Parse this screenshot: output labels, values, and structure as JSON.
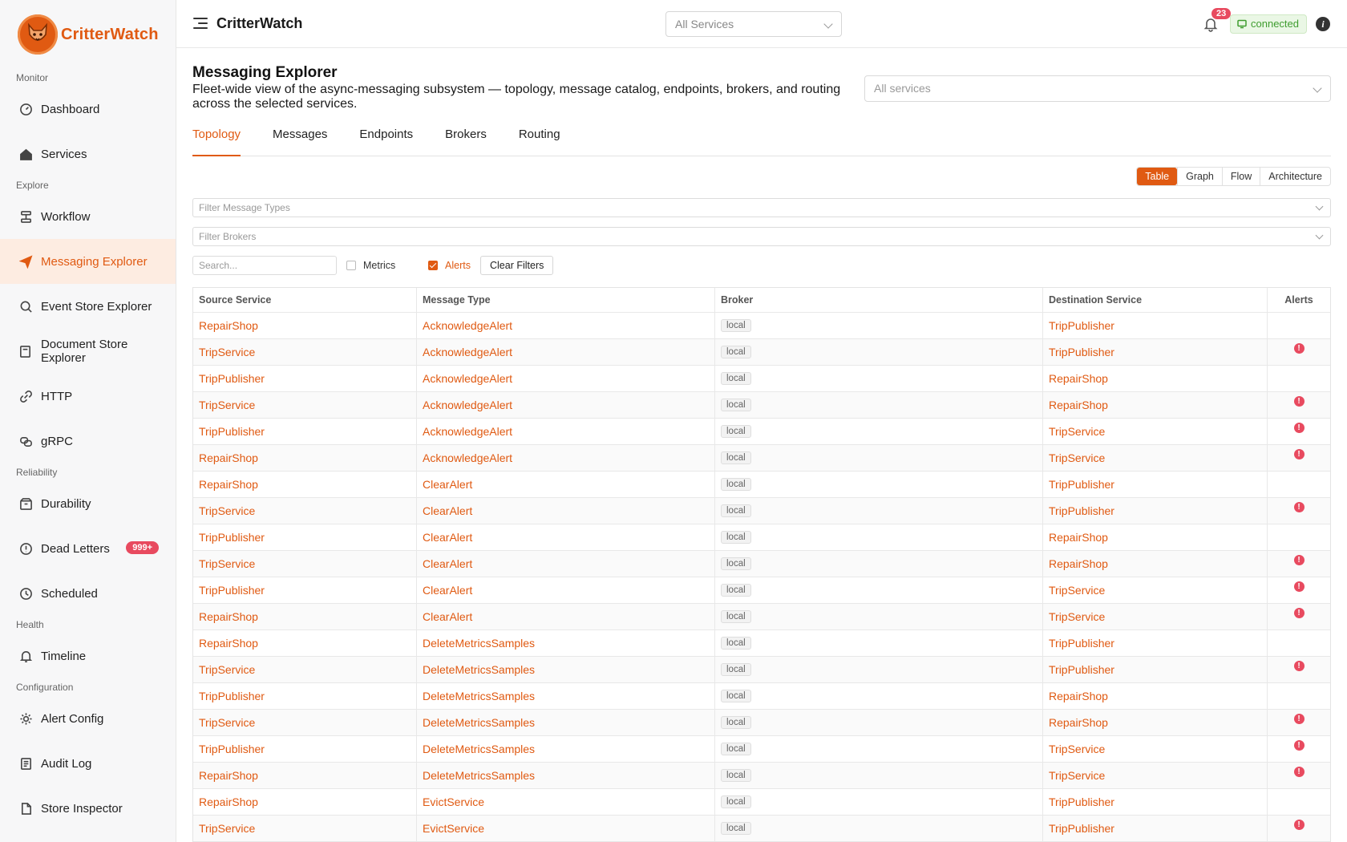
{
  "brand": {
    "name": "CritterWatch"
  },
  "topbar": {
    "title": "CritterWatch",
    "service_select": "All Services",
    "notifications_count": "23",
    "connection_status": "connected"
  },
  "sidebar": {
    "sections": [
      {
        "label": "Monitor",
        "items": [
          {
            "label": "Dashboard",
            "icon": "gauge-icon"
          },
          {
            "label": "Services",
            "icon": "home-icon"
          }
        ]
      },
      {
        "label": "Explore",
        "items": [
          {
            "label": "Workflow",
            "icon": "workflow-icon"
          },
          {
            "label": "Messaging Explorer",
            "icon": "send-icon",
            "active": true
          },
          {
            "label": "Event Store Explorer",
            "icon": "search-icon"
          },
          {
            "label": "Document Store Explorer",
            "icon": "book-icon"
          },
          {
            "label": "HTTP",
            "icon": "link-icon"
          },
          {
            "label": "gRPC",
            "icon": "grpc-icon"
          }
        ]
      },
      {
        "label": "Reliability",
        "items": [
          {
            "label": "Durability",
            "icon": "package-icon"
          },
          {
            "label": "Dead Letters",
            "icon": "alert-circle-icon",
            "badge": "999+"
          },
          {
            "label": "Scheduled",
            "icon": "clock-icon"
          }
        ]
      },
      {
        "label": "Health",
        "items": [
          {
            "label": "Timeline",
            "icon": "bell-icon"
          }
        ]
      },
      {
        "label": "Configuration",
        "items": [
          {
            "label": "Alert Config",
            "icon": "gear-icon"
          },
          {
            "label": "Audit Log",
            "icon": "log-icon"
          },
          {
            "label": "Store Inspector",
            "icon": "file-icon"
          }
        ]
      }
    ]
  },
  "page": {
    "title": "Messaging Explorer",
    "description": "Fleet-wide view of the async-messaging subsystem — topology, message catalog, endpoints, brokers, and routing across the selected services.",
    "services_select": "All services",
    "tabs": [
      "Topology",
      "Messages",
      "Endpoints",
      "Brokers",
      "Routing"
    ],
    "active_tab": "Topology",
    "view_modes": [
      "Table",
      "Graph",
      "Flow",
      "Architecture"
    ],
    "active_view": "Table",
    "filter_message_types_placeholder": "Filter Message Types",
    "filter_brokers_placeholder": "Filter Brokers",
    "search_placeholder": "Search...",
    "metrics_label": "Metrics",
    "metrics_checked": false,
    "alerts_label": "Alerts",
    "alerts_checked": true,
    "clear_filters_label": "Clear Filters"
  },
  "table": {
    "columns": [
      "Source Service",
      "Message Type",
      "Broker",
      "Destination Service",
      "Alerts"
    ],
    "rows": [
      {
        "source": "RepairShop",
        "message": "AcknowledgeAlert",
        "broker": "local",
        "destination": "TripPublisher",
        "alert": false
      },
      {
        "source": "TripService",
        "message": "AcknowledgeAlert",
        "broker": "local",
        "destination": "TripPublisher",
        "alert": true
      },
      {
        "source": "TripPublisher",
        "message": "AcknowledgeAlert",
        "broker": "local",
        "destination": "RepairShop",
        "alert": false
      },
      {
        "source": "TripService",
        "message": "AcknowledgeAlert",
        "broker": "local",
        "destination": "RepairShop",
        "alert": true
      },
      {
        "source": "TripPublisher",
        "message": "AcknowledgeAlert",
        "broker": "local",
        "destination": "TripService",
        "alert": true
      },
      {
        "source": "RepairShop",
        "message": "AcknowledgeAlert",
        "broker": "local",
        "destination": "TripService",
        "alert": true
      },
      {
        "source": "RepairShop",
        "message": "ClearAlert",
        "broker": "local",
        "destination": "TripPublisher",
        "alert": false
      },
      {
        "source": "TripService",
        "message": "ClearAlert",
        "broker": "local",
        "destination": "TripPublisher",
        "alert": true
      },
      {
        "source": "TripPublisher",
        "message": "ClearAlert",
        "broker": "local",
        "destination": "RepairShop",
        "alert": false
      },
      {
        "source": "TripService",
        "message": "ClearAlert",
        "broker": "local",
        "destination": "RepairShop",
        "alert": true
      },
      {
        "source": "TripPublisher",
        "message": "ClearAlert",
        "broker": "local",
        "destination": "TripService",
        "alert": true
      },
      {
        "source": "RepairShop",
        "message": "ClearAlert",
        "broker": "local",
        "destination": "TripService",
        "alert": true
      },
      {
        "source": "RepairShop",
        "message": "DeleteMetricsSamples",
        "broker": "local",
        "destination": "TripPublisher",
        "alert": false
      },
      {
        "source": "TripService",
        "message": "DeleteMetricsSamples",
        "broker": "local",
        "destination": "TripPublisher",
        "alert": true
      },
      {
        "source": "TripPublisher",
        "message": "DeleteMetricsSamples",
        "broker": "local",
        "destination": "RepairShop",
        "alert": false
      },
      {
        "source": "TripService",
        "message": "DeleteMetricsSamples",
        "broker": "local",
        "destination": "RepairShop",
        "alert": true
      },
      {
        "source": "TripPublisher",
        "message": "DeleteMetricsSamples",
        "broker": "local",
        "destination": "TripService",
        "alert": true
      },
      {
        "source": "RepairShop",
        "message": "DeleteMetricsSamples",
        "broker": "local",
        "destination": "TripService",
        "alert": true
      },
      {
        "source": "RepairShop",
        "message": "EvictService",
        "broker": "local",
        "destination": "TripPublisher",
        "alert": false
      },
      {
        "source": "TripService",
        "message": "EvictService",
        "broker": "local",
        "destination": "TripPublisher",
        "alert": true
      }
    ]
  },
  "colors": {
    "accent": "#e05a12",
    "alert": "#e84a5f",
    "connected": "#3f9d2f"
  }
}
